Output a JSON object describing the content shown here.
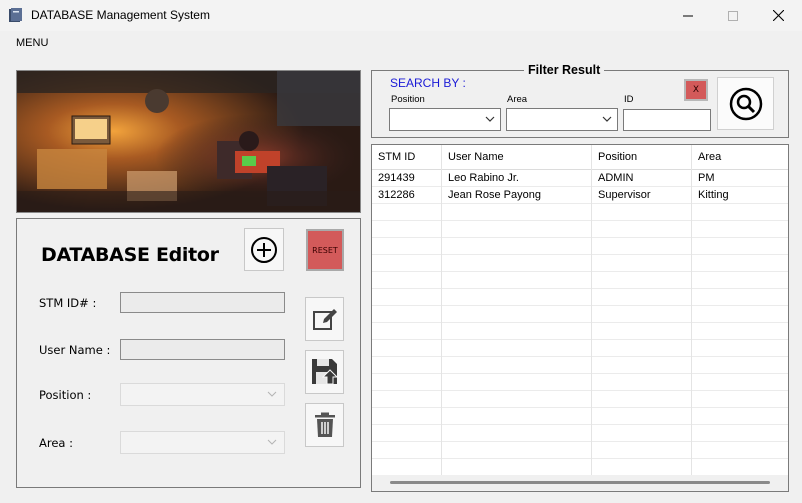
{
  "window": {
    "title": "DATABASE Management System"
  },
  "menu": {
    "items": [
      "MENU"
    ]
  },
  "banner": {
    "description": "illustration",
    "icon": "lofi-room-illustration"
  },
  "editor": {
    "title": "DATABASE Editor",
    "stm_id_label": "STM ID# :",
    "user_name_label": "User Name :",
    "position_label": "Position :",
    "area_label": "Area :",
    "stm_id_value": "",
    "user_name_value": "",
    "reset_label": "RESET"
  },
  "filter": {
    "title": "Filter Result",
    "search_by": "SEARCH BY :",
    "position_label": "Position",
    "area_label": "Area",
    "id_label": "ID",
    "clear_label": "X"
  },
  "grid": {
    "columns": [
      "STM ID",
      "User Name",
      "Position",
      "Area"
    ],
    "rows": [
      [
        "291439",
        "Leo Rabino Jr.",
        "ADMIN",
        "PM"
      ],
      [
        "312286",
        "Jean Rose Payong",
        "Supervisor",
        "Kitting"
      ]
    ]
  },
  "colors": {
    "reset_bg": "#d35a5a",
    "search_by_text": "#1a1ad6"
  }
}
